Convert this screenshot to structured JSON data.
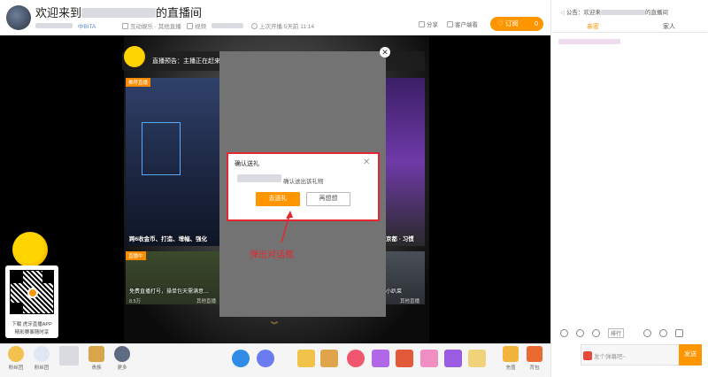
{
  "header": {
    "title_prefix": "欢迎来到",
    "title_suffix": "的直播间",
    "level": "中BITA",
    "category_main": "互动娱乐",
    "category_sub": "其他直播",
    "video_label": "视频",
    "last_live": "上次开播 5天前 11:14",
    "share_label": "分享",
    "client_label": "客户端看",
    "subscribe_label": "订阅",
    "subscribe_count": "0"
  },
  "player": {
    "notice": "直播预告：主播正在赶来",
    "tiles": [
      {
        "tag": "推荐直播",
        "caption": "跨6收金币、打造、增幅、强化",
        "sub": ""
      },
      {
        "tag": "",
        "caption": "京都 · 习惯",
        "sub": ""
      },
      {
        "tag": "直播中",
        "caption": "免费直播打号，操单包天需满意…",
        "sub": "8.5万"
      },
      {
        "tag": "",
        "caption": "小趴菜",
        "sub": "其他直播"
      }
    ],
    "sub_tile_caption_right": "其他直播"
  },
  "dialog": {
    "title": "确认送礼",
    "message": "确认送出该礼物",
    "confirm_label": "去送礼",
    "cancel_label": "再想想"
  },
  "annotation": "弹出对话框",
  "qr": {
    "line1": "下载 虎牙直播APP",
    "line2": "精彩赛事随时享"
  },
  "toolbar": {
    "left_items": [
      {
        "label": "粉丝团",
        "icon": "fan-club-icon"
      },
      {
        "label": "粉丝团",
        "icon": "fan-badge-icon"
      },
      {
        "label": "",
        "icon": "avatar-icon"
      },
      {
        "label": "贵族",
        "icon": "noble-icon"
      },
      {
        "label": "更多",
        "icon": "more-icon"
      }
    ],
    "recharge_label": "充值",
    "pack_label": "背包"
  },
  "right_panel": {
    "notice": "公告：欢迎来",
    "notice_suffix": "的直播间",
    "tab_active": "亲密",
    "tab_other": "家人",
    "chat_placeholder": "发个弹幕吧~",
    "send_label": "发送",
    "tool_btn": "排行"
  },
  "colors": {
    "accent": "#ff9600",
    "danger": "#e3282f"
  }
}
